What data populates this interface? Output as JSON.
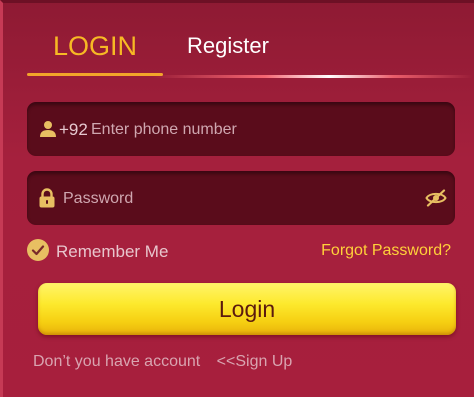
{
  "tabs": {
    "login_label": "LOGIN",
    "register_label": "Register",
    "active": "login"
  },
  "phone": {
    "prefix": "+92",
    "placeholder": "Enter phone number",
    "value": ""
  },
  "password": {
    "placeholder": "Password",
    "value": ""
  },
  "remember": {
    "label": "Remember Me",
    "checked": true
  },
  "forgot_label": "Forgot Password?",
  "login_button_label": "Login",
  "signup": {
    "prompt": "Don’t you have account",
    "link_label": "<<Sign Up"
  },
  "colors": {
    "background": "#a71f3d",
    "accent": "#f7b924",
    "button": "#fde92d",
    "field": "#5a0c1b"
  },
  "icons": [
    "user-icon",
    "lock-icon",
    "eye-slash-icon",
    "check-circle-icon"
  ]
}
